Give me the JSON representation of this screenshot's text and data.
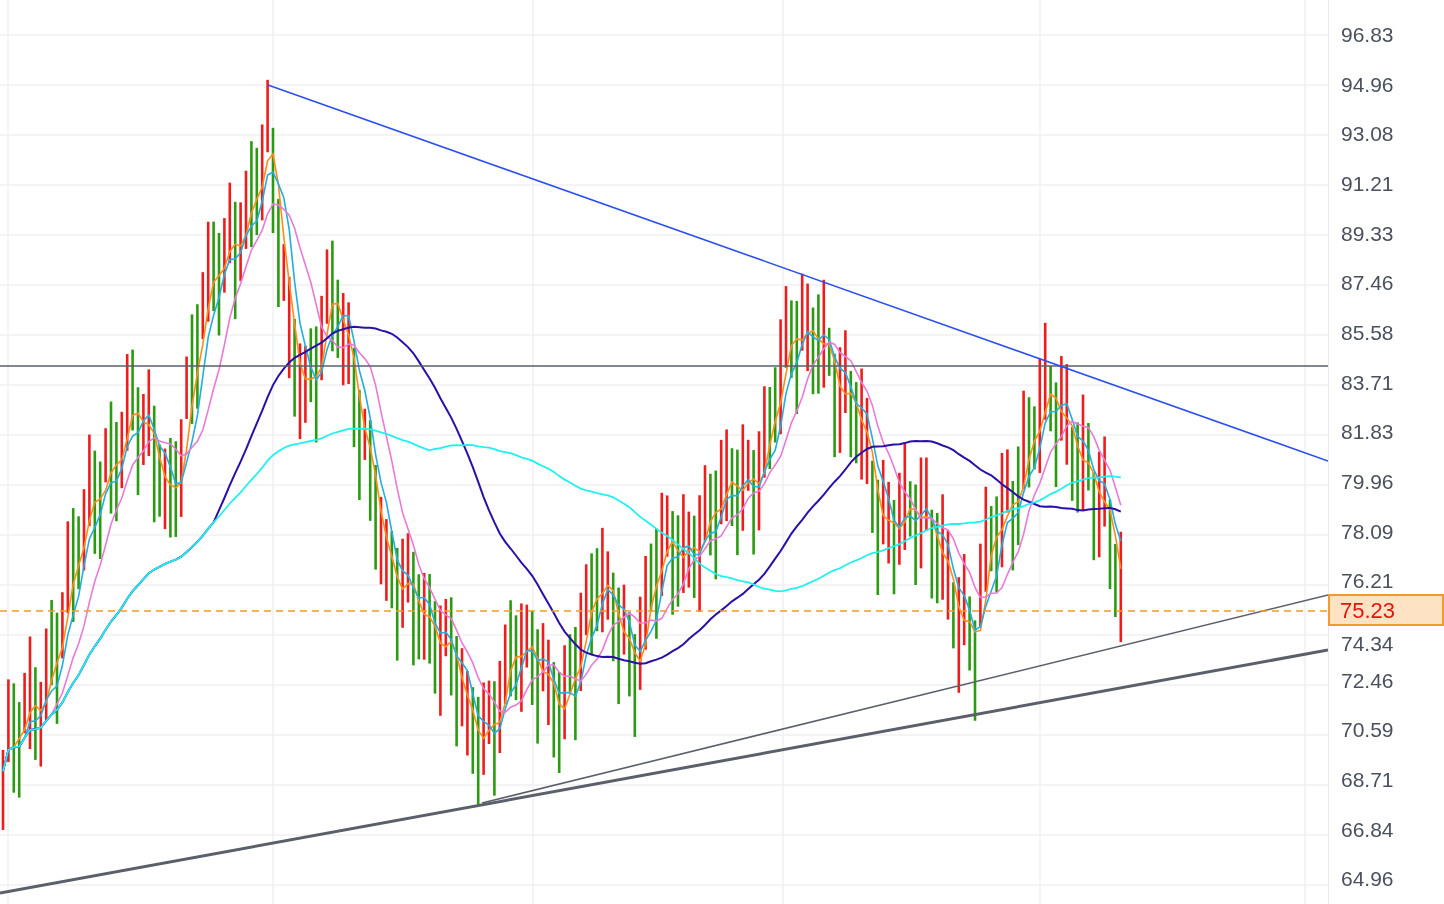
{
  "price_axis": {
    "labels": [
      "96.83",
      "94.96",
      "93.08",
      "91.21",
      "89.33",
      "87.46",
      "85.58",
      "83.71",
      "81.83",
      "79.96",
      "78.09",
      "76.21",
      "74.34",
      "72.46",
      "70.59",
      "68.71",
      "66.84",
      "64.96"
    ]
  },
  "last_price": {
    "label": "75.23"
  }
}
